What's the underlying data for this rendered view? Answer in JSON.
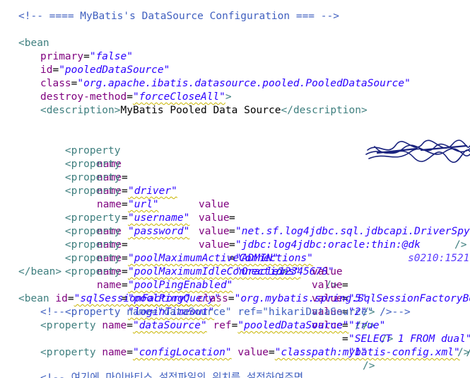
{
  "editor": {
    "line1": {
      "comment": "<!-- ==== MyBatis's DataSource Configuration === -->"
    },
    "line2": {
      "tag_open": "<bean"
    },
    "line3": {
      "attr": "primary",
      "eq": "=",
      "value": "\"false\""
    },
    "line4": {
      "attr": "id",
      "eq": "=",
      "value": "\"pooledDataSource\""
    },
    "line5": {
      "attr": "class",
      "eq": "=",
      "value": "\"org.apache.ibatis.datasource.pooled.PooledDataSource\""
    },
    "line6": {
      "attr": "destroy-method",
      "eq": "=",
      "value": "\"forceCloseAll\"",
      "close": ">"
    },
    "line7": {
      "open": "<description>",
      "text": "MyBatis Pooled Data Source",
      "close": "</description>"
    },
    "line8": {
      "tag": "<property",
      "a1": "name",
      "eq1": "=",
      "v1": "\"driver\"",
      "a2": "value",
      "eq2": "=",
      "v2": "\"net.sf.log4jdbc.sql.jdbcapi.DriverSpy\"",
      "end": "/>"
    },
    "line9": {
      "tag": "<property",
      "a1": "name",
      "eq1": "=",
      "v1": "\"url\"",
      "a2": "value",
      "eq2": "=",
      "v2": "\"jdbc:log4jdbc:oracle:thin:@dk",
      "v2_hidden": "s0210:1521:xe\"/>"
    },
    "line10": {
      "tag": "<property",
      "a1": "name",
      "eq1": "=",
      "v1": "\"username\"",
      "a2": "value",
      "eq2": "=",
      "v2": "\"ADMIN\"",
      "end": "/>"
    },
    "line11": {
      "tag": "<property",
      "a1": "name",
      "eq1": "=",
      "v1": "\"password\"",
      "a2": "value",
      "eq2": "=",
      "v2": "\"Oracle12345678\"",
      "end": "/>"
    },
    "line12": {
      "tag": "<property",
      "a1": "name",
      "eq1": "=",
      "v1": "\"poolMaximumActiveConnections\"",
      "a2": "value",
      "eq2": "=",
      "v2": "\"5\"",
      "end": "/>"
    },
    "line13": {
      "tag": "<property",
      "a1": "name",
      "eq1": "=",
      "v1": "\"poolMaximumIdleConnections\"",
      "a2": "value",
      "eq2": "=",
      "v2": "\"2\"",
      "end": "/>"
    },
    "line14": {
      "tag": "<property",
      "a1": "name",
      "eq1": "=",
      "v1": "\"poolPingEnabled\"",
      "a2": "value",
      "eq2": "=",
      "v2": "\"true\"",
      "end": "/>"
    },
    "line15": {
      "tag": "<property",
      "a1": "name",
      "eq1": "=",
      "v1": "\"poolPingQuery\"",
      "a2": "value",
      "eq2": "=",
      "v2": "\"SELECT 1 FROM dual\"",
      "end": "/>"
    },
    "line16": {
      "tag": "<property",
      "a1": "name",
      "eq1": "=",
      "v1": "\"loginTimeout\"",
      "a2": "value",
      "eq2": "=",
      "v2": "\"1\"",
      "end": "/>"
    },
    "line17": {
      "close": "</bean>"
    },
    "line18": {
      "tag": "<bean",
      "a1": "id",
      "eq1": "=",
      "v1": "\"sqlSessionFactory\"",
      "a2": "class",
      "eq2": "=",
      "v2": "\"org.mybatis.spring.SqlSessionFactoryBean\"",
      "end": ">"
    },
    "line19": {
      "comment": "<!--<property name=\"dataSource\" ref=\"hikariDataSource\" />-->"
    },
    "line20": {
      "tag": "<property",
      "a1": "name",
      "eq1": "=",
      "v1": "\"dataSource\"",
      "a2": "ref",
      "eq2": "=",
      "v2": "\"pooledDataSource\"",
      "end": " />"
    },
    "line21": {
      "tag": "<property",
      "a1": "name",
      "eq1": "=",
      "v1": "\"configLocation\"",
      "a2": "value",
      "eq2": "=",
      "v2": "\"classpath:mybatis-config.xml\"",
      "end": " />"
    },
    "line22": {
      "comment": "<!-- 여기에 마이바티스 설정파일의 위치를 설정하여주면"
    }
  },
  "colors": {
    "comment": "#3f5fbf",
    "tag": "#3f7f7f",
    "attribute_name": "#7f007f",
    "attribute_value": "#2a00ff",
    "text": "#000000",
    "background": "#ffffff",
    "redaction_scribble": "#1a237e"
  }
}
